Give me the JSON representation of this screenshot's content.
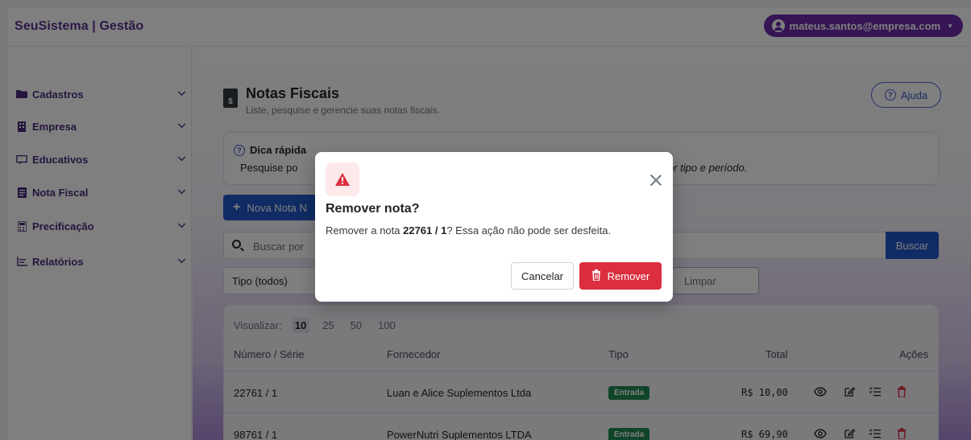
{
  "app": {
    "brand": "SeuSistema | Gestão",
    "user_email": "mateus.santos@empresa.com"
  },
  "sidebar": {
    "items": [
      {
        "label": "Cadastros",
        "icon": "folder-icon"
      },
      {
        "label": "Empresa",
        "icon": "building-icon"
      },
      {
        "label": "Educativos",
        "icon": "chalkboard-icon"
      },
      {
        "label": "Nota Fiscal",
        "icon": "receipt-icon"
      },
      {
        "label": "Precificação",
        "icon": "calculator-icon"
      },
      {
        "label": "Relatórios",
        "icon": "report-icon"
      }
    ]
  },
  "page": {
    "title": "Notas Fiscais",
    "subtitle": "Liste, pesquise e gerencie suas notas fiscais.",
    "help_label": "Ajuda"
  },
  "tip": {
    "title": "Dica rápida",
    "text": "Pesquise po",
    "text_tail": "or tipo e período."
  },
  "actions": {
    "new_label": "Nova Nota N",
    "search_placeholder": "Buscar por",
    "search_label": "Buscar",
    "type_filter": "Tipo (todos)",
    "clear_label": "Limpar"
  },
  "table": {
    "view_label": "Visualizar:",
    "page_sizes": [
      "10",
      "25",
      "50",
      "100"
    ],
    "active_page_size": "10",
    "headers": {
      "numero": "Número / Série",
      "fornecedor": "Fornecedor",
      "tipo": "Tipo",
      "total": "Total",
      "acoes": "Ações"
    },
    "rows": [
      {
        "numero": "22761 / 1",
        "fornecedor": "Luan e Alice Suplementos Ltda",
        "tipo": "Entrada",
        "total": "R$ 10,00"
      },
      {
        "numero": "98761 / 1",
        "fornecedor": "PowerNutri Suplementos LTDA",
        "tipo": "Entrada",
        "total": "R$ 69,90"
      }
    ]
  },
  "modal": {
    "title": "Remover nota?",
    "body_prefix": "Remover a nota ",
    "body_number": "22761 / 1",
    "body_suffix": "? Essa ação não pode ser desfeita.",
    "cancel_label": "Cancelar",
    "remove_label": "Remover"
  },
  "colors": {
    "brand_purple": "#6a2aa8",
    "primary_blue": "#2358c9",
    "danger_red": "#dc2e3e",
    "success_green": "#218a55"
  }
}
